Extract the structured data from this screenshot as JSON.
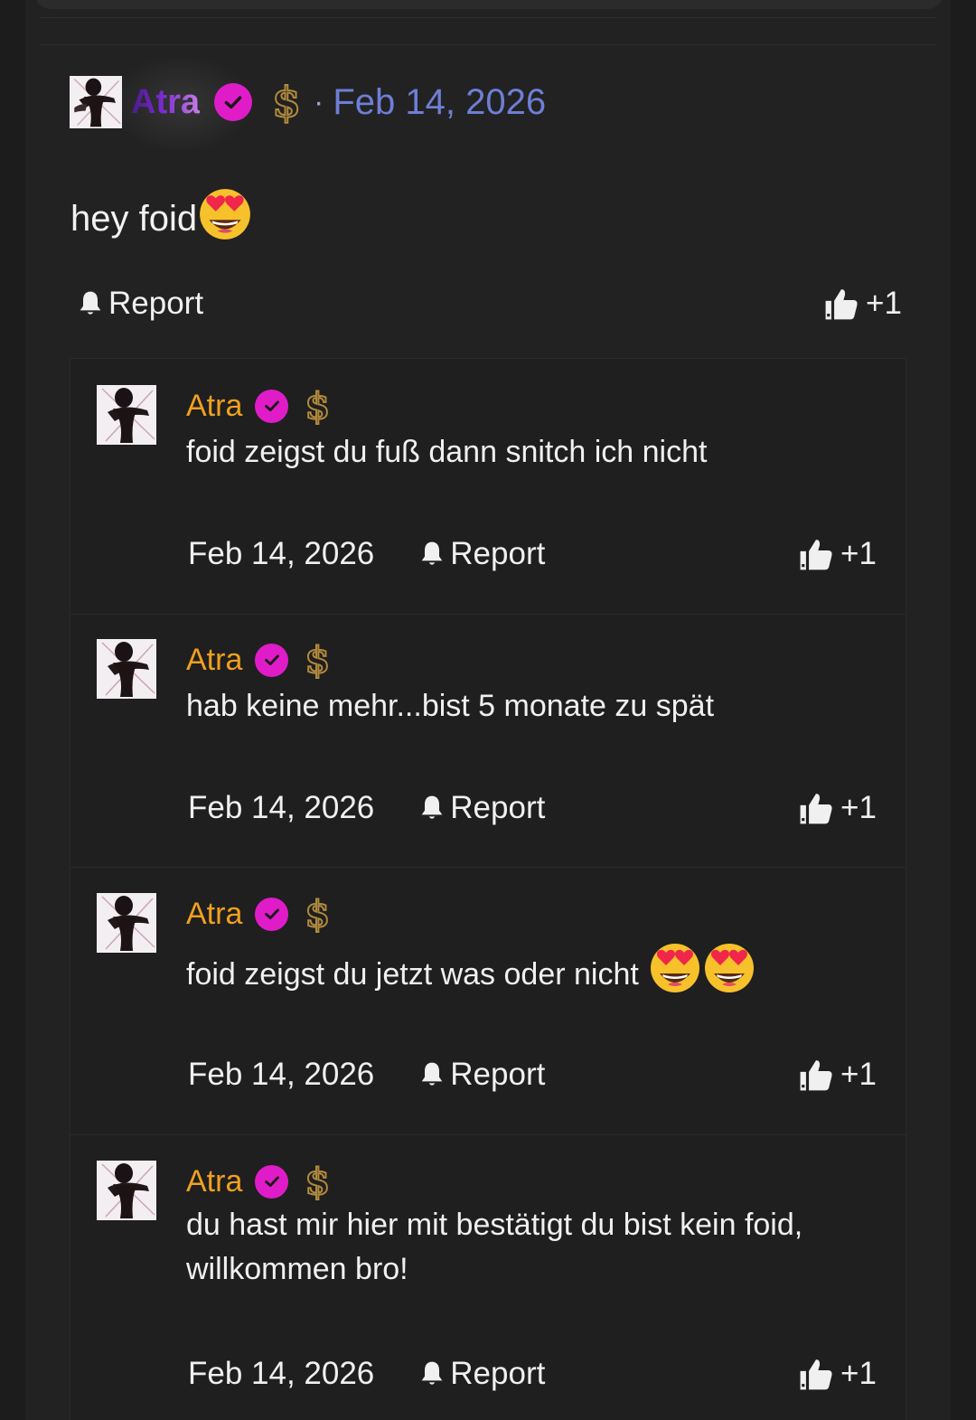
{
  "post": {
    "author": "Atra",
    "separator": "·",
    "date": "Feb 14, 2026",
    "text": "hey foid",
    "text_emoji": "star-struck-emoji",
    "report_label": "Report",
    "like_label": "+1"
  },
  "replies": [
    {
      "author": "Atra",
      "text": "foid zeigst du fuß dann snitch ich nicht",
      "date": "Feb 14, 2026",
      "report_label": "Report",
      "like_label": "+1"
    },
    {
      "author": "Atra",
      "text": "hab keine mehr...bist 5 monate zu spät",
      "date": "Feb 14, 2026",
      "report_label": "Report",
      "like_label": "+1"
    },
    {
      "author": "Atra",
      "text": "foid zeigst du jetzt was oder nicht",
      "date": "Feb 14, 2026",
      "report_label": "Report",
      "like_label": "+1"
    },
    {
      "author": "Atra",
      "text": "du hast mir hier mit bestätigt du bist kein foid, willkommen bro!",
      "date": "Feb 14, 2026",
      "report_label": "Report",
      "like_label": "+1"
    }
  ],
  "colors": {
    "username_gradient": [
      "#4a1a8a",
      "#c77ee8"
    ],
    "reply_username": "#f0a020",
    "verified_badge": "#e01cc8",
    "main_date": "#6f7ed6",
    "dollar_badge": "#b18a3c"
  },
  "icons": {
    "verified": "verified-check-icon",
    "supporter": "dollar-icon",
    "report": "bell-icon",
    "like": "thumbs-up-icon"
  }
}
